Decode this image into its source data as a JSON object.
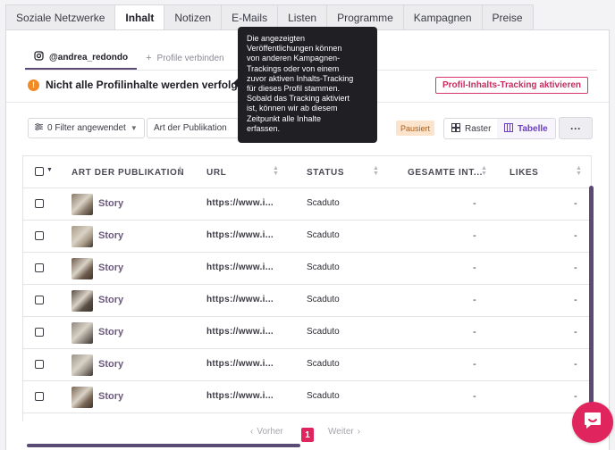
{
  "tabs": [
    {
      "label": "Soziale Netzwerke",
      "active": false
    },
    {
      "label": "Inhalt",
      "active": true
    },
    {
      "label": "Notizen",
      "active": false
    },
    {
      "label": "E-Mails",
      "active": false
    },
    {
      "label": "Listen",
      "active": false
    },
    {
      "label": "Programme",
      "active": false
    },
    {
      "label": "Kampagnen",
      "active": false
    },
    {
      "label": "Preise",
      "active": false
    }
  ],
  "profile": {
    "handle": "@andrea_redondo",
    "connect_label": "Profile verbinden"
  },
  "warning": {
    "text": "Nicht alle Profilinhalte werden verfolgt",
    "activate_label": "Profil-Inhalts-Tracking aktivieren"
  },
  "tooltip": {
    "lines": [
      "Die angezeigten",
      "Veröffentlichungen können",
      "von anderen Kampagnen-",
      "Trackings oder von einem",
      "zuvor aktiven Inhalts-Tracking",
      "für dieses Profil stammen.",
      "Sobald das Tracking aktiviert",
      "ist, können wir ab diesem",
      "Zeitpunkt alle Inhalte",
      "erfassen."
    ]
  },
  "filters": {
    "applied_label": "0 Filter angewendet",
    "type_label": "Art der Publikation",
    "paused_label": "Pausiert",
    "grid_label": "Raster",
    "table_label": "Tabelle",
    "more_label": "···"
  },
  "table": {
    "columns": [
      "ART DER PUBLIKATION",
      "URL",
      "STATUS",
      "GESAMTE INT...",
      "LIKES"
    ],
    "rows": [
      {
        "type": "Story",
        "url": "https://www.i...",
        "status": "Scaduto",
        "interactions": "-",
        "likes": "-",
        "thumb_color": "#8a7a68"
      },
      {
        "type": "Story",
        "url": "https://www.i...",
        "status": "Scaduto",
        "interactions": "-",
        "likes": "-",
        "thumb_color": "#a89a86"
      },
      {
        "type": "Story",
        "url": "https://www.i...",
        "status": "Scaduto",
        "interactions": "-",
        "likes": "-",
        "thumb_color": "#6e5c4c"
      },
      {
        "type": "Story",
        "url": "https://www.i...",
        "status": "Scaduto",
        "interactions": "-",
        "likes": "-",
        "thumb_color": "#5a4e44"
      },
      {
        "type": "Story",
        "url": "https://www.i...",
        "status": "Scaduto",
        "interactions": "-",
        "likes": "-",
        "thumb_color": "#8d8880"
      },
      {
        "type": "Story",
        "url": "https://www.i...",
        "status": "Scaduto",
        "interactions": "-",
        "likes": "-",
        "thumb_color": "#9a938a"
      },
      {
        "type": "Story",
        "url": "https://www.i...",
        "status": "Scaduto",
        "interactions": "-",
        "likes": "-",
        "thumb_color": "#7a6654"
      }
    ]
  },
  "pagination": {
    "prev_label": "Vorher",
    "current_page": "1",
    "next_label": "Weiter"
  },
  "colors": {
    "accent": "#e0245e",
    "brand_purple": "#5b4a74",
    "warning_orange": "#f08a24"
  }
}
